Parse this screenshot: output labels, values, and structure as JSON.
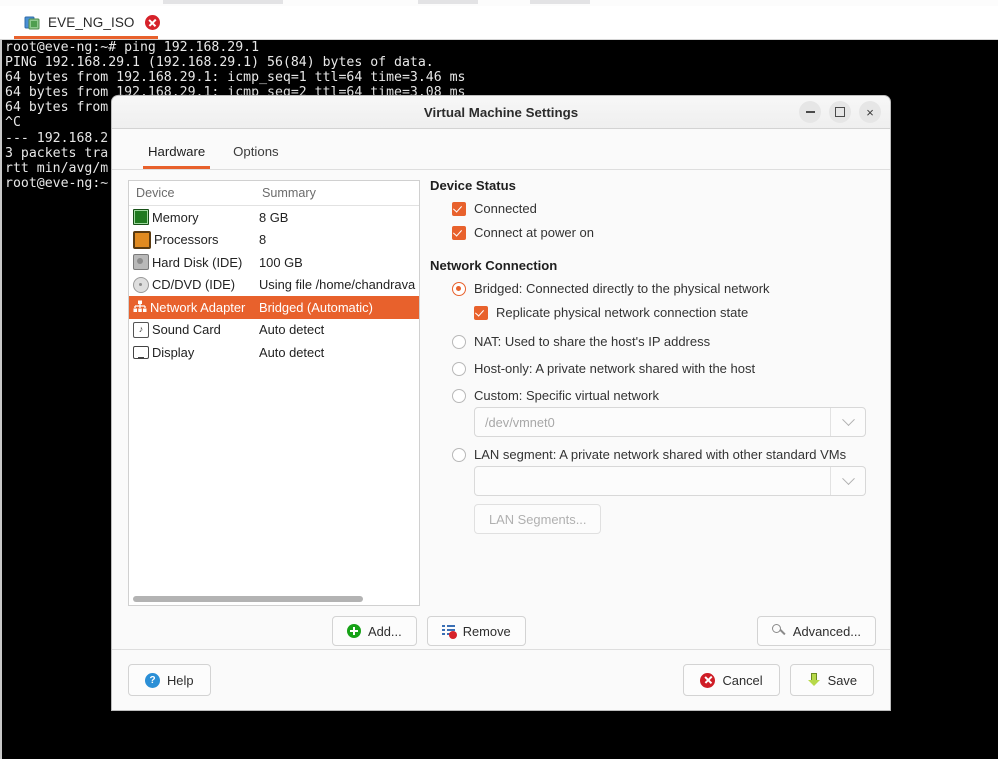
{
  "tab": {
    "label": "EVE_NG_ISO",
    "icon": "vm-icon",
    "close_icon": "close-icon"
  },
  "terminal": {
    "lines": [
      "root@eve-ng:~# ping 192.168.29.1",
      "PING 192.168.29.1 (192.168.29.1) 56(84) bytes of data.",
      "64 bytes from 192.168.29.1: icmp_seq=1 ttl=64 time=3.46 ms",
      "64 bytes from 192.168.29.1: icmp_seq=2 ttl=64 time=3.08 ms",
      "64 bytes from",
      "^C",
      "--- 192.168.2",
      "3 packets tra",
      "rtt min/avg/m",
      "root@eve-ng:~"
    ]
  },
  "dialog": {
    "title": "Virtual Machine Settings",
    "window_buttons": {
      "minimize": "minimize-icon",
      "maximize": "maximize-icon",
      "close": "×"
    },
    "tabs": [
      {
        "label": "Hardware",
        "active": true
      },
      {
        "label": "Options",
        "active": false
      }
    ],
    "device_list": {
      "columns": [
        "Device",
        "Summary"
      ],
      "rows": [
        {
          "icon": "memory-icon",
          "device": "Memory",
          "summary": "8 GB",
          "selected": false
        },
        {
          "icon": "cpu-icon",
          "device": "Processors",
          "summary": "8",
          "selected": false
        },
        {
          "icon": "harddisk-icon",
          "device": "Hard Disk (IDE)",
          "summary": "100 GB",
          "selected": false
        },
        {
          "icon": "cddvd-icon",
          "device": "CD/DVD (IDE)",
          "summary": "Using file /home/chandrava",
          "selected": false
        },
        {
          "icon": "network-icon",
          "device": "Network Adapter",
          "summary": "Bridged (Automatic)",
          "selected": true
        },
        {
          "icon": "sound-icon",
          "device": "Sound Card",
          "summary": "Auto detect",
          "selected": false
        },
        {
          "icon": "display-icon",
          "device": "Display",
          "summary": "Auto detect",
          "selected": false
        }
      ]
    },
    "device_buttons": {
      "add": "Add...",
      "remove": "Remove",
      "advanced": "Advanced..."
    },
    "right_pane": {
      "device_status": {
        "heading": "Device Status",
        "connected": {
          "label": "Connected",
          "checked": true
        },
        "connect_at_power_on": {
          "label": "Connect at power on",
          "checked": true
        }
      },
      "network_connection": {
        "heading": "Network Connection",
        "options": [
          {
            "label": "Bridged: Connected directly to the physical network",
            "selected": true
          },
          {
            "label": "NAT: Used to share the host's IP address",
            "selected": false
          },
          {
            "label": "Host-only: A private network shared with the host",
            "selected": false
          },
          {
            "label": "Custom: Specific virtual network",
            "selected": false
          },
          {
            "label": "LAN segment: A private network shared with other standard VMs",
            "selected": false
          }
        ],
        "replicate": {
          "label": "Replicate physical network connection state",
          "checked": true
        },
        "custom_select": {
          "value": "/dev/vmnet0"
        },
        "lan_select": {
          "value": ""
        },
        "lan_segments_button": "LAN Segments..."
      }
    },
    "footer": {
      "help": "Help",
      "cancel": "Cancel",
      "save": "Save"
    }
  },
  "colors": {
    "accent": "#e8612c",
    "terminal_bg": "#000000",
    "dialog_bg": "#fafafa"
  }
}
